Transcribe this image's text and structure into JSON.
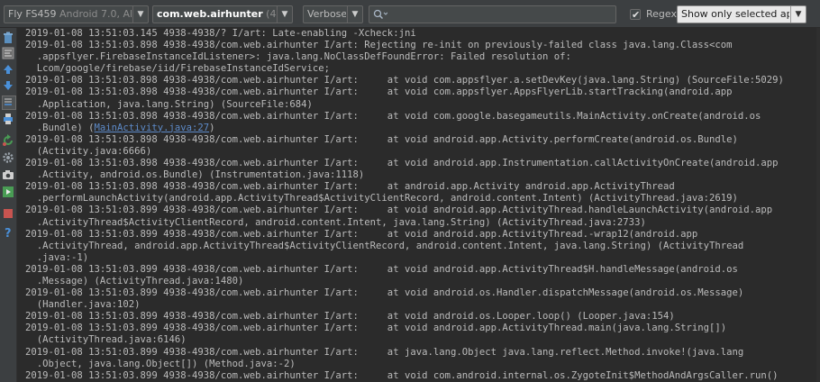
{
  "toolbar": {
    "device_name": "Fly FS459",
    "device_os": "Android 7.0, AI",
    "process_name": "com.web.airhunter",
    "process_pid": "(4938)",
    "log_level": "Verbose",
    "search_value": "",
    "search_placeholder": "",
    "regex_label": "Regex",
    "regex_checked": true,
    "filter_value": "Show only selected applica"
  },
  "sidebar": {
    "icons": [
      "trash-icon",
      "soft-wrap-icon",
      "scroll-up-icon",
      "scroll-down-icon",
      "scroll-to-end-icon",
      "print-icon",
      "restart-icon",
      "settings-icon",
      "screenshot-icon",
      "screen-record-icon",
      "stop-icon",
      "help-icon"
    ]
  },
  "log": {
    "link_text": "MainActivity.java:27",
    "lines": [
      "2019-01-08 13:51:03.145 4938-4938/? I/art: Late-enabling -Xcheck:jni",
      "2019-01-08 13:51:03.898 4938-4938/com.web.airhunter I/art: Rejecting re-init on previously-failed class java.lang.Class<com",
      "  .appsflyer.FirebaseInstanceIdListener>: java.lang.NoClassDefFoundError: Failed resolution of:",
      "  Lcom/google/firebase/iid/FirebaseInstanceIdService;",
      "2019-01-08 13:51:03.898 4938-4938/com.web.airhunter I/art:     at void com.appsflyer.a.setDevKey(java.lang.String) (SourceFile:5029)",
      "2019-01-08 13:51:03.898 4938-4938/com.web.airhunter I/art:     at void com.appsflyer.AppsFlyerLib.startTracking(android.app",
      "  .Application, java.lang.String) (SourceFile:684)",
      "2019-01-08 13:51:03.898 4938-4938/com.web.airhunter I/art:     at void com.google.basegameutils.MainActivity.onCreate(android.os",
      "  .Bundle) (",
      "2019-01-08 13:51:03.898 4938-4938/com.web.airhunter I/art:     at void android.app.Activity.performCreate(android.os.Bundle)",
      "  (Activity.java:6666)",
      "2019-01-08 13:51:03.898 4938-4938/com.web.airhunter I/art:     at void android.app.Instrumentation.callActivityOnCreate(android.app",
      "  .Activity, android.os.Bundle) (Instrumentation.java:1118)",
      "2019-01-08 13:51:03.898 4938-4938/com.web.airhunter I/art:     at android.app.Activity android.app.ActivityThread",
      "  .performLaunchActivity(android.app.ActivityThread$ActivityClientRecord, android.content.Intent) (ActivityThread.java:2619)",
      "2019-01-08 13:51:03.899 4938-4938/com.web.airhunter I/art:     at void android.app.ActivityThread.handleLaunchActivity(android.app",
      "  .ActivityThread$ActivityClientRecord, android.content.Intent, java.lang.String) (ActivityThread.java:2733)",
      "2019-01-08 13:51:03.899 4938-4938/com.web.airhunter I/art:     at void android.app.ActivityThread.-wrap12(android.app",
      "  .ActivityThread, android.app.ActivityThread$ActivityClientRecord, android.content.Intent, java.lang.String) (ActivityThread",
      "  .java:-1)",
      "2019-01-08 13:51:03.899 4938-4938/com.web.airhunter I/art:     at void android.app.ActivityThread$H.handleMessage(android.os",
      "  .Message) (ActivityThread.java:1480)",
      "2019-01-08 13:51:03.899 4938-4938/com.web.airhunter I/art:     at void android.os.Handler.dispatchMessage(android.os.Message)",
      "  (Handler.java:102)",
      "2019-01-08 13:51:03.899 4938-4938/com.web.airhunter I/art:     at void android.os.Looper.loop() (Looper.java:154)",
      "2019-01-08 13:51:03.899 4938-4938/com.web.airhunter I/art:     at void android.app.ActivityThread.main(java.lang.String[])",
      "  (ActivityThread.java:6146)",
      "2019-01-08 13:51:03.899 4938-4938/com.web.airhunter I/art:     at java.lang.Object java.lang.reflect.Method.invoke!(java.lang",
      "  .Object, java.lang.Object[]) (Method.java:-2)",
      "2019-01-08 13:51:03.899 4938-4938/com.web.airhunter I/art:     at void com.android.internal.os.ZygoteInit$MethodAndArgsCaller.run()"
    ]
  }
}
